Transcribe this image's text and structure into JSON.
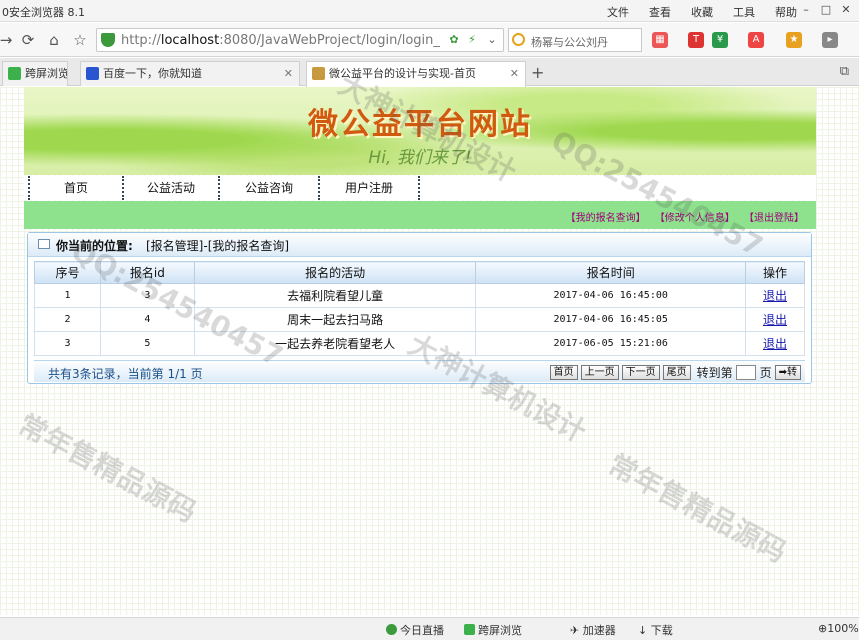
{
  "browser": {
    "app_title": "0安全浏览器 8.1",
    "menu": [
      "文件",
      "查看",
      "收藏",
      "工具",
      "帮助"
    ],
    "url_prefix": "http://",
    "url_host": "localhost",
    "url_rest": ":8080/JavaWebProject/login/login_",
    "search_text": "杨幂与公公刘丹",
    "tabs": [
      {
        "label": "跨屏浏览"
      },
      {
        "label": "百度一下，你就知道"
      },
      {
        "label": "微公益平台的设计与实现-首页"
      }
    ]
  },
  "site": {
    "title": "微公益平台网站",
    "slogan": "Hi, 我们来了!",
    "nav": [
      "首页",
      "公益活动",
      "公益咨询",
      "用户注册"
    ],
    "user_links": [
      "【我的报名查询】",
      "【修改个人信息】",
      "【退出登陆】"
    ]
  },
  "panel": {
    "location_label": "你当前的位置:",
    "location_path": "[报名管理]-[我的报名查询]",
    "columns": [
      "序号",
      "报名id",
      "报名的活动",
      "报名时间",
      "操作"
    ],
    "rows": [
      {
        "no": "1",
        "id": "3",
        "activity": "去福利院看望儿童",
        "time": "2017-04-06 16:45:00",
        "action": "退出"
      },
      {
        "no": "2",
        "id": "4",
        "activity": "周末一起去扫马路",
        "time": "2017-04-06 16:45:05",
        "action": "退出"
      },
      {
        "no": "3",
        "id": "5",
        "activity": "一起去养老院看望老人",
        "time": "2017-06-05 15:21:06",
        "action": "退出"
      }
    ],
    "summary": "共有3条记录，当前第 1/1 页",
    "pager": {
      "first": "首页",
      "prev": "上一页",
      "next": "下一页",
      "last": "尾页",
      "jump_label": "转到第",
      "page_unit": "页",
      "go": "➡转"
    }
  },
  "statusbar": {
    "items": [
      "今日直播",
      "跨屏浏览",
      "加速器",
      "下载",
      "100%"
    ]
  },
  "watermarks": [
    "大神计算机设计",
    "QQ:254540457",
    "常年售精品源码"
  ]
}
